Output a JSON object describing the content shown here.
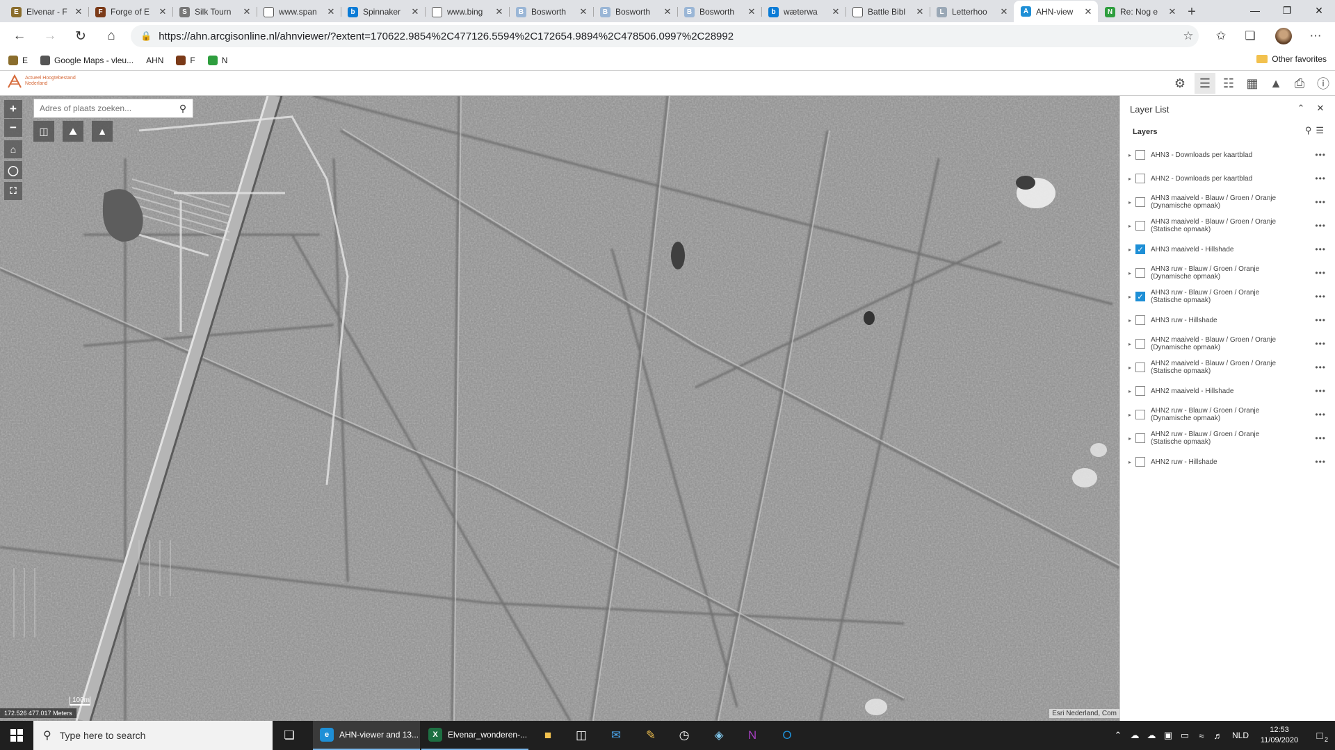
{
  "browser": {
    "tabs": [
      {
        "title": "Elvenar - F",
        "icon_color": "#8a6d2c",
        "icon_text": "E"
      },
      {
        "title": "Forge of E",
        "icon_color": "#7b3a18",
        "icon_text": "F"
      },
      {
        "title": "Silk Tourn",
        "icon_color": "#777777",
        "icon_text": "S"
      },
      {
        "title": "www.span",
        "icon_color": "#ffffff",
        "icon_text": ""
      },
      {
        "title": "Spinnaker",
        "icon_color": "#0a7bd6",
        "icon_text": "b"
      },
      {
        "title": "www.bing",
        "icon_color": "#ffffff",
        "icon_text": ""
      },
      {
        "title": "Bosworth",
        "icon_color": "#9ab6d6",
        "icon_text": "B"
      },
      {
        "title": "Bosworth",
        "icon_color": "#9ab6d6",
        "icon_text": "B"
      },
      {
        "title": "Bosworth",
        "icon_color": "#9ab6d6",
        "icon_text": "B"
      },
      {
        "title": "wæterwa",
        "icon_color": "#0a7bd6",
        "icon_text": "b"
      },
      {
        "title": "Battle Bibl",
        "icon_color": "#ffffff",
        "icon_text": ""
      },
      {
        "title": "Letterhoo",
        "icon_color": "#9aa8b6",
        "icon_text": "L"
      },
      {
        "title": "AHN-view",
        "icon_color": "#1e8fd6",
        "icon_text": "A"
      },
      {
        "title": "Re: Nog e",
        "icon_color": "#2e9e3e",
        "icon_text": "N"
      }
    ],
    "active_tab_index": 12,
    "url": "https://ahn.arcgisonline.nl/ahnviewer/?extent=170622.9854%2C477126.5594%2C172654.9894%2C478506.0997%2C28992",
    "favorites": [
      {
        "label": "E",
        "icon_color": "#8a6d2c"
      },
      {
        "label": "Google Maps - vleu...",
        "icon_color": "#555555"
      },
      {
        "label": "AHN",
        "icon_color": "#ffffff"
      },
      {
        "label": "F",
        "icon_color": "#7b3a18"
      },
      {
        "label": "N",
        "icon_color": "#2e9e3e"
      }
    ],
    "other_favorites": "Other favorites"
  },
  "app": {
    "logo_text": "Actueel Hoogtebestand Nederland"
  },
  "map": {
    "search_placeholder": "Adres of plaats zoeken...",
    "scale_label": "100m",
    "coordinates": "172.526 477.017 Meters",
    "attribution": "Esri Nederland, Com"
  },
  "layer_panel": {
    "title": "Layer List",
    "section": "Layers",
    "layers": [
      {
        "name": "AHN3 - Downloads per kaartblad",
        "checked": false
      },
      {
        "name": "AHN2 - Downloads per kaartblad",
        "checked": false
      },
      {
        "name": "AHN3 maaiveld - Blauw / Groen / Oranje (Dynamische opmaak)",
        "checked": false
      },
      {
        "name": "AHN3 maaiveld - Blauw / Groen / Oranje (Statische opmaak)",
        "checked": false
      },
      {
        "name": "AHN3 maaiveld - Hillshade",
        "checked": true
      },
      {
        "name": "AHN3 ruw - Blauw / Groen / Oranje (Dynamische opmaak)",
        "checked": false
      },
      {
        "name": "AHN3 ruw - Blauw / Groen / Oranje (Statische opmaak)",
        "checked": true
      },
      {
        "name": "AHN3 ruw - Hillshade",
        "checked": false
      },
      {
        "name": "AHN2 maaiveld - Blauw / Groen / Oranje (Dynamische opmaak)",
        "checked": false
      },
      {
        "name": "AHN2 maaiveld - Blauw / Groen / Oranje (Statische opmaak)",
        "checked": false
      },
      {
        "name": "AHN2 maaiveld - Hillshade",
        "checked": false
      },
      {
        "name": "AHN2 ruw - Blauw / Groen / Oranje (Dynamische opmaak)",
        "checked": false
      },
      {
        "name": "AHN2 ruw - Blauw / Groen / Oranje (Statische opmaak)",
        "checked": false
      },
      {
        "name": "AHN2 ruw - Hillshade",
        "checked": false
      }
    ]
  },
  "taskbar": {
    "search_placeholder": "Type here to search",
    "apps": [
      {
        "label": "AHN-viewer and 13...",
        "icon_color": "#1e8fd6",
        "icon_text": "e",
        "active": true
      },
      {
        "label": "Elvenar_wonderen-...",
        "icon_color": "#1d6f42",
        "icon_text": "X",
        "active": false
      }
    ],
    "language": "NLD",
    "time": "12:53",
    "date": "11/09/2020",
    "notification_count": "2"
  },
  "colors": {
    "accent": "#1e8fd6",
    "checkbox_checked": "#1e8fd6",
    "taskbar_bg": "#1f1f1f"
  }
}
